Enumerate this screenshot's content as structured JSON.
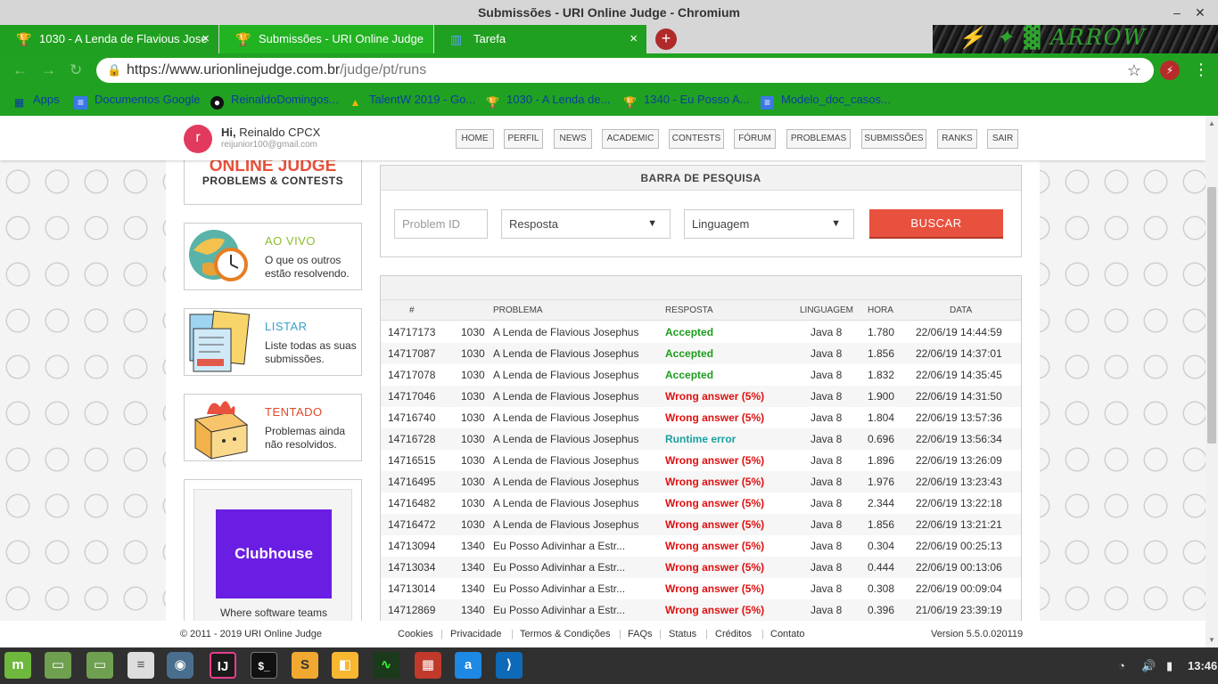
{
  "window": {
    "title": "Submissões - URI Online Judge - Chromium"
  },
  "tabs": [
    {
      "label": "1030 - A Lenda de Flavious Jose",
      "close": "×"
    },
    {
      "label": "Submissões - URI Online Judge",
      "close": "×"
    },
    {
      "label": "Tarefa",
      "close": "×"
    }
  ],
  "newtab": "+",
  "address": {
    "host": "https://www.urionlinejudge.com.br",
    "path": "/judge/pt/runs"
  },
  "bookmarks": [
    "Apps",
    "Documentos Google",
    "ReinaldoDomingos...",
    "TalentW 2019 - Go...",
    "1030 - A Lenda de...",
    "1340 - Eu Posso A...",
    "Modelo_doc_casos..."
  ],
  "header": {
    "avatar_letter": "r",
    "hi": "Hi,",
    "name": "Reinaldo CPCX",
    "email": "reijunior100@gmail.com",
    "nav": [
      "HOME",
      "PERFIL",
      "NEWS",
      "ACADEMIC",
      "CONTESTS",
      "FÓRUM",
      "PROBLEMAS",
      "SUBMISSÕES",
      "RANKS",
      "SAIR"
    ]
  },
  "logo": {
    "line1": "ONLINE JUDGE",
    "line2": "PROBLEMS & CONTESTS"
  },
  "cards": [
    {
      "title": "AO VIVO",
      "desc": "O que os outros estão resolvendo.",
      "color": "#8bbf2a"
    },
    {
      "title": "LISTAR",
      "desc": "Liste todas as suas submissões.",
      "color": "#3aa0c8"
    },
    {
      "title": "TENTADO",
      "desc": "Problemas ainda não resolvidos.",
      "color": "#e04a2a"
    }
  ],
  "ad": {
    "brand": "Clubhouse",
    "tagline": "Where software teams"
  },
  "search": {
    "title": "BARRA DE PESQUISA",
    "problem_placeholder": "Problem ID",
    "answer_select": "Resposta",
    "language_select": "Linguagem",
    "button": "BUSCAR"
  },
  "table": {
    "headers": [
      "#",
      "PROBLEMA",
      "RESPOSTA",
      "LINGUAGEM",
      "HORA",
      "DATA"
    ],
    "rows": [
      [
        "14717173",
        "1030",
        "A Lenda de Flavious Josephus",
        "Accepted",
        "Java 8",
        "1.780",
        "22/06/19 14:44:59"
      ],
      [
        "14717087",
        "1030",
        "A Lenda de Flavious Josephus",
        "Accepted",
        "Java 8",
        "1.856",
        "22/06/19 14:37:01"
      ],
      [
        "14717078",
        "1030",
        "A Lenda de Flavious Josephus",
        "Accepted",
        "Java 8",
        "1.832",
        "22/06/19 14:35:45"
      ],
      [
        "14717046",
        "1030",
        "A Lenda de Flavious Josephus",
        "Wrong answer (5%)",
        "Java 8",
        "1.900",
        "22/06/19 14:31:50"
      ],
      [
        "14716740",
        "1030",
        "A Lenda de Flavious Josephus",
        "Wrong answer (5%)",
        "Java 8",
        "1.804",
        "22/06/19 13:57:36"
      ],
      [
        "14716728",
        "1030",
        "A Lenda de Flavious Josephus",
        "Runtime error",
        "Java 8",
        "0.696",
        "22/06/19 13:56:34"
      ],
      [
        "14716515",
        "1030",
        "A Lenda de Flavious Josephus",
        "Wrong answer (5%)",
        "Java 8",
        "1.896",
        "22/06/19 13:26:09"
      ],
      [
        "14716495",
        "1030",
        "A Lenda de Flavious Josephus",
        "Wrong answer (5%)",
        "Java 8",
        "1.976",
        "22/06/19 13:23:43"
      ],
      [
        "14716482",
        "1030",
        "A Lenda de Flavious Josephus",
        "Wrong answer (5%)",
        "Java 8",
        "2.344",
        "22/06/19 13:22:18"
      ],
      [
        "14716472",
        "1030",
        "A Lenda de Flavious Josephus",
        "Wrong answer (5%)",
        "Java 8",
        "1.856",
        "22/06/19 13:21:21"
      ],
      [
        "14713094",
        "1340",
        "Eu Posso Adivinhar a Estr...",
        "Wrong answer (5%)",
        "Java 8",
        "0.304",
        "22/06/19 00:25:13"
      ],
      [
        "14713034",
        "1340",
        "Eu Posso Adivinhar a Estr...",
        "Wrong answer (5%)",
        "Java 8",
        "0.444",
        "22/06/19 00:13:06"
      ],
      [
        "14713014",
        "1340",
        "Eu Posso Adivinhar a Estr...",
        "Wrong answer (5%)",
        "Java 8",
        "0.308",
        "22/06/19 00:09:04"
      ],
      [
        "14712869",
        "1340",
        "Eu Posso Adivinhar a Estr...",
        "Wrong answer (5%)",
        "Java 8",
        "0.396",
        "21/06/19 23:39:19"
      ]
    ]
  },
  "status_colors": {
    "Accepted": "#1e9c1e",
    "Wrong answer (5%)": "#e01010",
    "Runtime error": "#1ba0a0"
  },
  "footer": {
    "copyright": "© 2011 - 2019 URI Online Judge",
    "links": [
      "Cookies",
      "Privacidade",
      "Termos & Condições",
      "FAQs",
      "Status",
      "Créditos",
      "Contato"
    ],
    "version": "Version 5.5.0.020119"
  },
  "taskbar": {
    "clock": "13:46"
  }
}
